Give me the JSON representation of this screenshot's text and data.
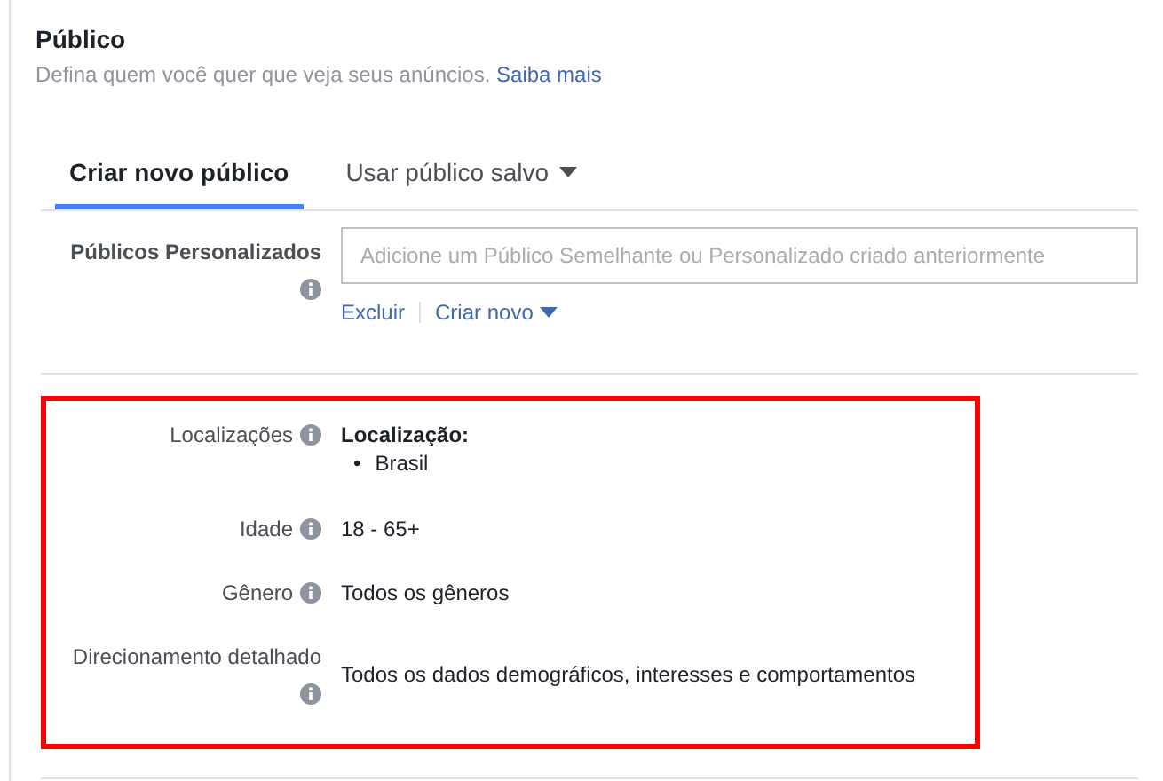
{
  "section": {
    "title": "Público",
    "subtitle": "Defina quem você quer que veja seus anúncios.",
    "link": "Saiba mais"
  },
  "tabs": [
    {
      "label": "Criar novo público",
      "selected": true,
      "dropdown": false
    },
    {
      "label": "Usar público salvo",
      "selected": false,
      "dropdown": true
    }
  ],
  "custom_audiences": {
    "label": "Públicos Personalizados",
    "placeholder": "Adicione um Público Semelhante ou Personalizado criado anteriormente",
    "actions": [
      {
        "label": "Excluir",
        "dropdown": false
      },
      {
        "label": "Criar novo",
        "dropdown": true
      }
    ]
  },
  "summary": {
    "highlighted": true,
    "rows": [
      {
        "label": "Localizações",
        "kind": "list",
        "heading": "Localização:",
        "items": [
          {
            "bullet": "•",
            "label": "Brasil"
          }
        ]
      },
      {
        "label": "Idade",
        "kind": "text",
        "value": "18 - 65+"
      },
      {
        "label": "Gênero",
        "kind": "text",
        "value": "Todos os gêneros"
      },
      {
        "label": "Direcionamento detalhado",
        "kind": "text",
        "value": "Todos os dados demográficos, interesses e comportamentos"
      }
    ]
  }
}
